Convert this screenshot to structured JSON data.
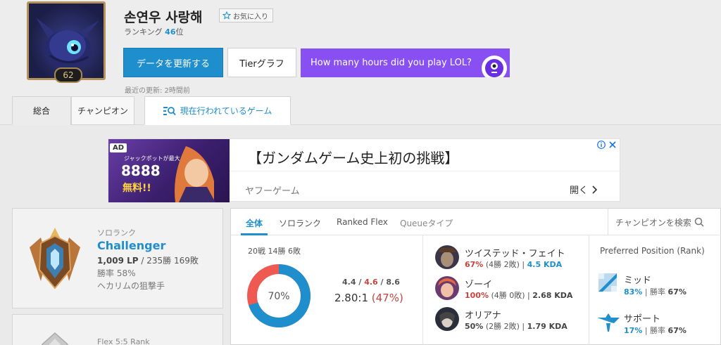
{
  "summoner": {
    "name": "손연우 사랑해",
    "favorite_label": "お気に入り",
    "ranking_label": "ランキング",
    "ranking_value": "46",
    "ranking_suffix": "位",
    "level": "62"
  },
  "actions": {
    "update_label": "データを更新する",
    "tier_graph_label": "Tierグラフ",
    "promo_label": "How many hours did you play LOL?"
  },
  "last_update": "最近の更新: 2時間前",
  "tabs": [
    {
      "label": "総合"
    },
    {
      "label": "チャンピオン"
    },
    {
      "label": "現在行われているゲーム"
    }
  ],
  "ad": {
    "badge": "AD",
    "headline": "【ガンダムゲーム史上初の挑戦】",
    "source": "ヤフーゲーム",
    "open_label": "開く",
    "image_text_1": "ジャックポットが最大",
    "image_text_2": "8888",
    "image_text_3": "無料!!"
  },
  "solo_rank": {
    "queue": "ソロランク",
    "tier": "Challenger",
    "lp": "1,009 LP",
    "record": " / 235勝 169敗",
    "winrate": "勝率 58%",
    "title": "ヘカリムの狙撃手"
  },
  "flex_rank": {
    "queue": "Flex 5:5 Rank"
  },
  "stats_tabs": [
    {
      "label": "全体"
    },
    {
      "label": "ソロランク"
    },
    {
      "label": "Ranked Flex"
    },
    {
      "label": "Queueタイプ"
    }
  ],
  "champion_search_label": "チャンピオンを検索",
  "summary": {
    "games": "20戦 14勝 6敗",
    "winrate_pct": 70,
    "winrate_label": "70%",
    "kills": "4.4",
    "deaths": "4.6",
    "assists": "8.6",
    "kda_ratio": "2.80:1",
    "kill_participation": "(47%)",
    "colors": {
      "win": "#1f8ecd",
      "loss": "#ee5a52"
    }
  },
  "champions": [
    {
      "name": "ツイステッド・フェイト",
      "winrate": "67%",
      "record": "(4勝 2敗)",
      "kda": "4.5 KDA",
      "wr_red": true,
      "kda_blue": true
    },
    {
      "name": "ゾーイ",
      "winrate": "100%",
      "record": "(4勝 0敗)",
      "kda": "2.68 KDA",
      "wr_red": true,
      "kda_blue": false
    },
    {
      "name": "オリアナ",
      "winrate": "50%",
      "record": "(2勝 2敗)",
      "kda": "1.79 KDA",
      "wr_red": false,
      "kda_blue": false
    }
  ],
  "positions": {
    "title": "Preferred Position (Rank)",
    "items": [
      {
        "name": "ミッド",
        "share": "83%",
        "winrate_label": "勝率",
        "winrate": "67%",
        "icon": "mid-lane-icon"
      },
      {
        "name": "サポート",
        "share": "17%",
        "winrate_label": "勝率",
        "winrate": "67%",
        "icon": "support-icon"
      }
    ]
  }
}
